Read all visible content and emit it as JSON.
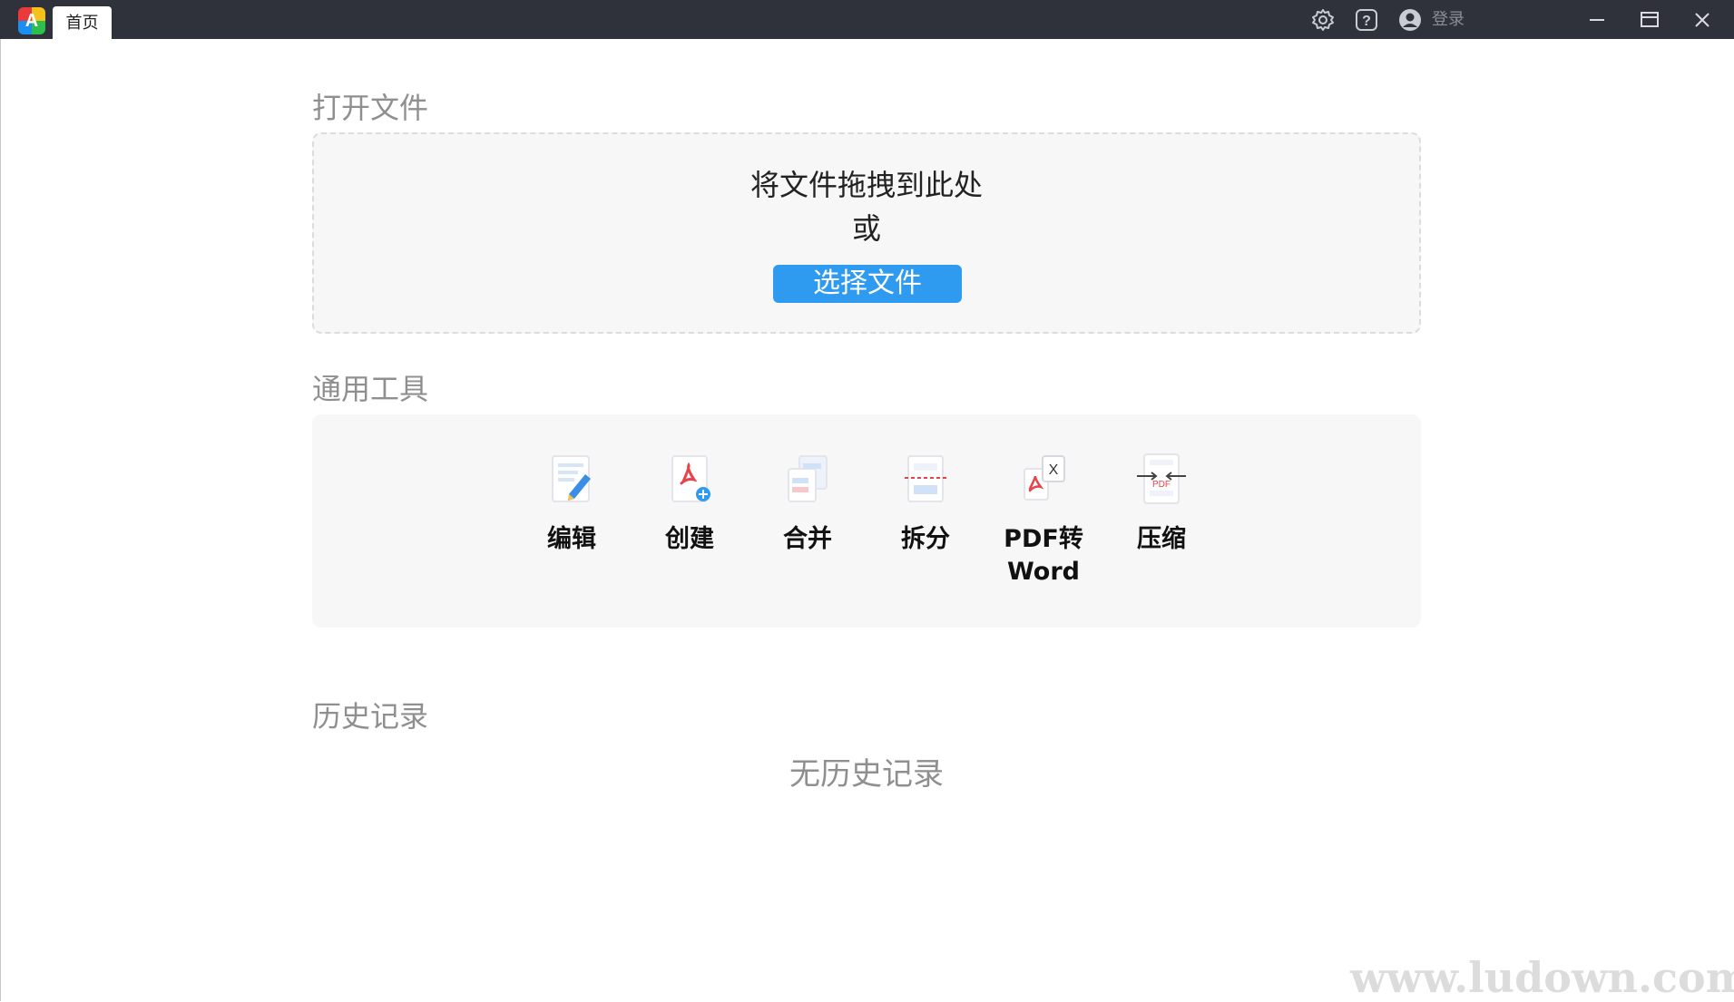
{
  "titlebar": {
    "tab_home": "首页",
    "login_label": "登录"
  },
  "open_file": {
    "title": "打开文件",
    "drop_hint": "将文件拖拽到此处",
    "or_text": "或",
    "select_button": "选择文件"
  },
  "tools": {
    "title": "通用工具",
    "items": [
      {
        "label": "编辑",
        "icon": "edit-doc-icon"
      },
      {
        "label": "创建",
        "icon": "create-pdf-icon"
      },
      {
        "label": "合并",
        "icon": "merge-icon"
      },
      {
        "label": "拆分",
        "icon": "split-icon"
      },
      {
        "label": "PDF转\nWord",
        "icon": "pdf-to-word-icon"
      },
      {
        "label": "压缩",
        "icon": "compress-icon"
      }
    ]
  },
  "history": {
    "title": "历史记录",
    "empty_text": "无历史记录"
  },
  "watermark": "www.ludown.com",
  "colors": {
    "titlebar": "#2f323a",
    "accent": "#2f9bf0",
    "panel": "#f7f7f7"
  }
}
